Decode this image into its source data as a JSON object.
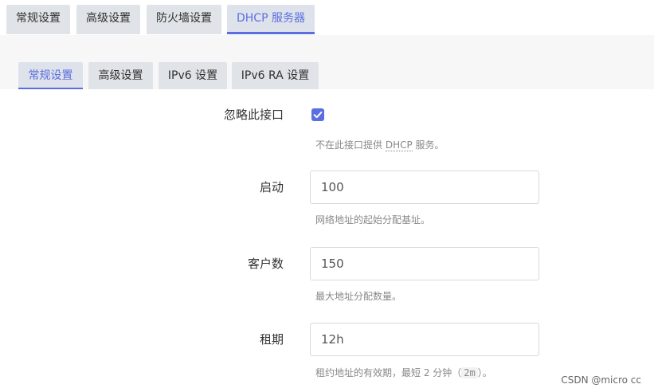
{
  "top_tabs": [
    {
      "label": "常规设置",
      "active": false
    },
    {
      "label": "高级设置",
      "active": false
    },
    {
      "label": "防火墙设置",
      "active": false
    },
    {
      "label": "DHCP 服务器",
      "active": true
    }
  ],
  "sub_tabs": [
    {
      "label": "常规设置",
      "active": true
    },
    {
      "label": "高级设置",
      "active": false
    },
    {
      "label": "IPv6 设置",
      "active": false
    },
    {
      "label": "IPv6 RA 设置",
      "active": false
    }
  ],
  "form": {
    "ignore_interface": {
      "label": "忽略此接口",
      "checked": true,
      "help_prefix": "不在此接口提供 ",
      "help_abbr": "DHCP",
      "help_suffix": " 服务。"
    },
    "start": {
      "label": "启动",
      "value": "100",
      "help": "网络地址的起始分配基址。"
    },
    "limit": {
      "label": "客户数",
      "value": "150",
      "help": "最大地址分配数量。"
    },
    "leasetime": {
      "label": "租期",
      "value": "12h",
      "help_prefix": "租约地址的有效期，最短 2 分钟（",
      "help_code": "2m",
      "help_suffix": "）。"
    }
  },
  "watermark": "CSDN @micro cc",
  "colors": {
    "accent": "#5b6ee1",
    "tab_bg": "#e0e4e8",
    "help_text": "#888888"
  }
}
